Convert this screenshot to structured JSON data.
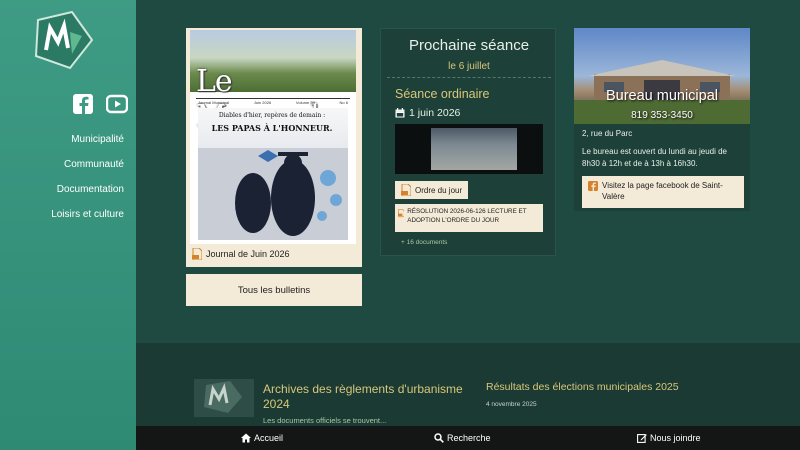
{
  "sidebar": {
    "logo_alt": "MSV",
    "nav": [
      "Municipalité",
      "Communauté",
      "Documentation",
      "Loisirs et culture"
    ],
    "social": [
      "facebook-icon",
      "youtube-icon"
    ]
  },
  "mensuel": {
    "cover_title": "Le Mensuel",
    "cover_meta": [
      "Journal Municipal",
      "Juin 2026",
      "Volume 30",
      "No 6"
    ],
    "cover_headline_1": "Diables d'hier, repères de demain :",
    "cover_headline_2": "LES PAPAS À L'HONNEUR.",
    "link": "Journal de Juin 2026",
    "button": "Tous les bulletins"
  },
  "seance": {
    "title": "Prochaine séance",
    "date": "le 6 juillet",
    "type": "Séance ordinaire",
    "day": "1 juin 2026",
    "odj": "Ordre du jour",
    "resolution": "RÉSOLUTION 2026-06-126 LECTURE ET ADOPTION L'ORDRE DU JOUR",
    "more": "+ 16 documents"
  },
  "bureau": {
    "title": "Bureau municipal",
    "phone": "819 353-3450",
    "address": "2, rue du Parc",
    "hours": "Le bureau est ouvert du lundi au jeudi de 8h30 à 12h et de à 13h à 16h30.",
    "fb_link": "Visitez la page facebook de Saint-Valère"
  },
  "news": [
    {
      "title": "Archives des règlements d'urbanisme 2024",
      "excerpt": "Les documents officiels se trouvent..."
    },
    {
      "title": "Résultats des élections municipales 2025",
      "date": "4 novembre 2025"
    }
  ],
  "footer": {
    "home": "Accueil",
    "search": "Recherche",
    "contact": "Nous joindre"
  },
  "colors": {
    "sidebar": "#3e9b84",
    "main": "#1f4a41",
    "accent_gold": "#d9c77a",
    "cream": "#f3ead7"
  }
}
